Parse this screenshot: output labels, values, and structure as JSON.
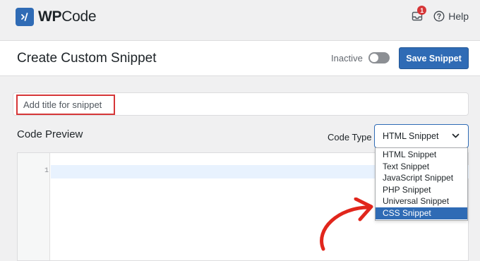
{
  "brand": {
    "name_bold": "WP",
    "name_rest": "Code"
  },
  "topbar": {
    "notification_count": "1",
    "help_label": "Help"
  },
  "header": {
    "title": "Create Custom Snippet",
    "status_label": "Inactive",
    "toggle_on": false,
    "save_label": "Save Snippet"
  },
  "title_input": {
    "placeholder": "Add title for snippet"
  },
  "code_preview": {
    "label": "Code Preview",
    "code_type_label": "Code Type",
    "selected_type": "HTML Snippet",
    "line_numbers": [
      "1"
    ]
  },
  "dropdown": {
    "options": [
      {
        "label": "HTML Snippet",
        "highlighted": false
      },
      {
        "label": "Text Snippet",
        "highlighted": false
      },
      {
        "label": "JavaScript Snippet",
        "highlighted": false
      },
      {
        "label": "PHP Snippet",
        "highlighted": false
      },
      {
        "label": "Universal Snippet",
        "highlighted": false
      },
      {
        "label": "CSS Snippet",
        "highlighted": true
      }
    ]
  },
  "colors": {
    "accent": "#2f6bb5",
    "annotation": "#e1261c",
    "badge": "#d63638"
  },
  "icons": {
    "logo": "code-slash-icon",
    "inbox": "inbox-icon",
    "help": "question-circle-icon",
    "chevron": "chevron-down-icon",
    "annotation": "curved-arrow-icon"
  }
}
